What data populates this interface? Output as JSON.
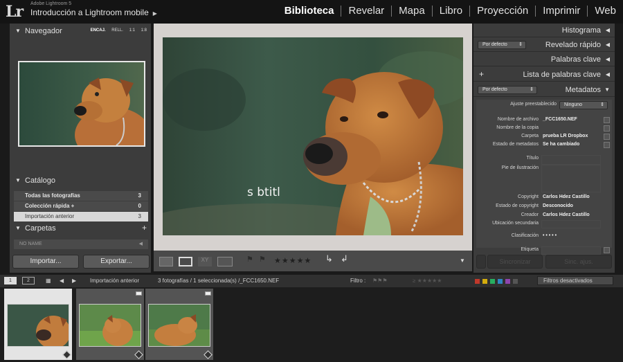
{
  "header": {
    "logo": "Lr",
    "product": "Adobe Lightroom 5",
    "catalog": "Introducción a Lightroom mobile",
    "modules": [
      "Biblioteca",
      "Revelar",
      "Mapa",
      "Libro",
      "Proyección",
      "Imprimir",
      "Web"
    ],
    "active_module": "Biblioteca"
  },
  "left_panel": {
    "navigator": {
      "title": "Navegador",
      "options": [
        "ENCAJ.",
        "RELL.",
        "1:1",
        "1:8"
      ]
    },
    "catalog": {
      "title": "Catálogo",
      "items": [
        {
          "label": "Todas las fotografías",
          "count": "3"
        },
        {
          "label": "Colección rápida +",
          "count": "0"
        },
        {
          "label": "Importación anterior",
          "count": "3"
        }
      ]
    },
    "folders": {
      "title": "Carpetas",
      "add": "+",
      "row_label": "NO NAME"
    },
    "import_button": "Importar...",
    "export_button": "Exportar..."
  },
  "center": {
    "subtitle_text": "s btitl"
  },
  "toolbar": {
    "stars": "★★★★★",
    "menu_icon": "▼"
  },
  "right_panel": {
    "panels": [
      "Histograma",
      "Revelado rápido",
      "Palabras clave",
      "Lista de palabras clave",
      "Metadatos"
    ],
    "quick_develop_preset": "Por defecto",
    "metadata_preset": "Por defecto",
    "plus": "+",
    "metadata": {
      "preset_label": "Ajuste preestablecido",
      "preset_value": "Ninguno",
      "file_name_label": "Nombre de archivo",
      "file_name": "_FCC1650.NEF",
      "copy_name_label": "Nombre de la copia",
      "copy_name": "",
      "folder_label": "Carpeta",
      "folder": "prueba LR Dropbox",
      "status_label": "Estado de metadatos",
      "status": "Se ha cambiado",
      "title_label": "Título",
      "caption_label": "Pie de ilustración",
      "copyright_label": "Copyright",
      "copyright": "Carlos Hdez Castillo",
      "copyright_status_label": "Estado de copyright",
      "copyright_status": "Desconocido",
      "creator_label": "Creador",
      "creator": "Carlos Hdez Castillo",
      "sublocation_label": "Ubicación secundaria",
      "rating_label": "Clasificación",
      "rating": "• • • • •",
      "label_label": "Etiqueta"
    },
    "sync_button": "Sincronizar",
    "sync_settings_button": "Sinc. ajus."
  },
  "filmstrip_bar": {
    "view1": "1",
    "view2": "2",
    "source": "Importación anterior",
    "info": "3 fotografías / 1 seleccionada(s) /_FCC1650.NEF",
    "filter_label": "Filtro :",
    "filter_state": "Filtros desactivados"
  },
  "colors": {
    "label_colors": [
      "#c0392b",
      "#d4ac0d",
      "#27ae60",
      "#2e86c1",
      "#8e44ad",
      "#555555"
    ]
  }
}
